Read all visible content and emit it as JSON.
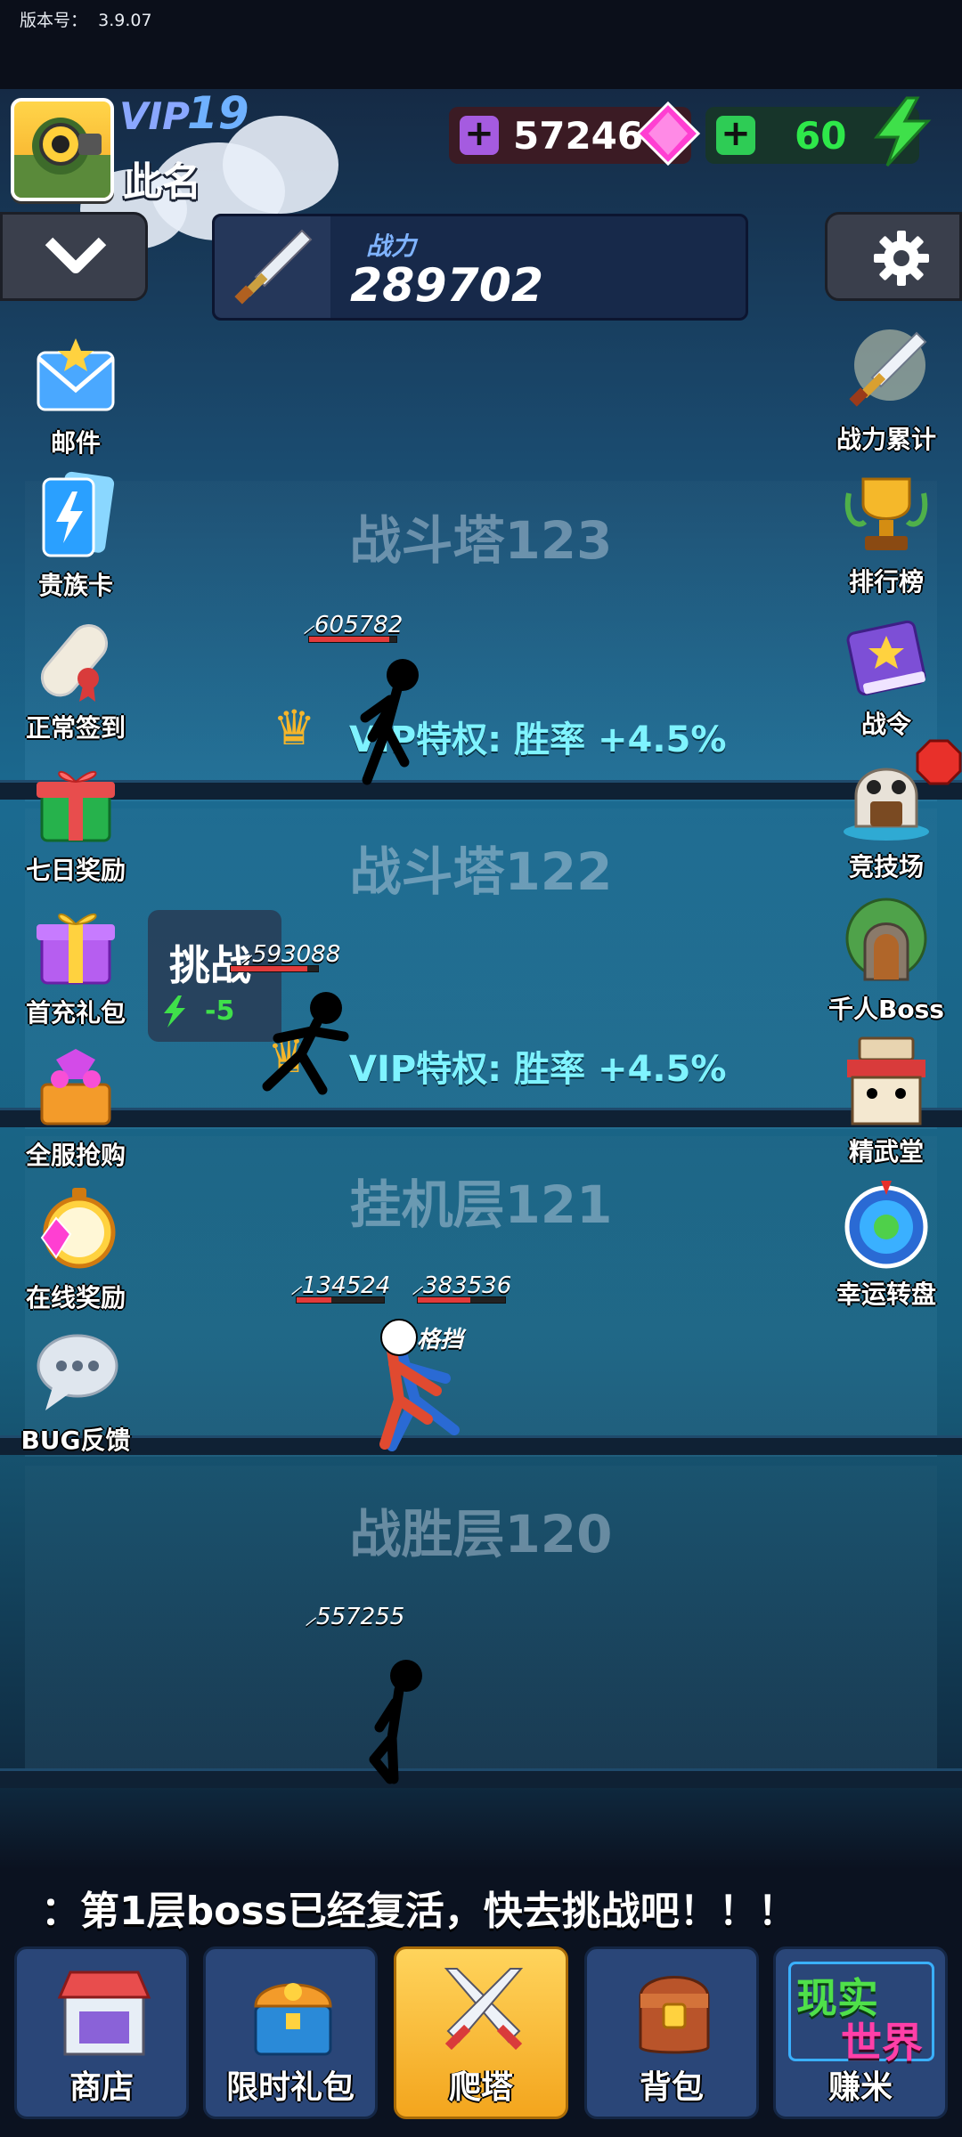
{
  "version": {
    "label": "版本号：",
    "value": "3.9.07"
  },
  "player": {
    "vip_label": "VIP",
    "vip_level": "19",
    "name": "此名"
  },
  "resources": {
    "gems": "57246",
    "energy": "60"
  },
  "power": {
    "label": "战力",
    "value": "289702"
  },
  "left_menu": [
    {
      "label": "邮件",
      "icon": "mail-icon"
    },
    {
      "label": "贵族卡",
      "icon": "noble-card-icon"
    },
    {
      "label": "正常签到",
      "icon": "scroll-icon"
    },
    {
      "label": "七日奖励",
      "icon": "gift-icon"
    },
    {
      "label": "首充礼包",
      "icon": "gift-box-icon"
    },
    {
      "label": "全服抢购",
      "icon": "treasure-icon"
    },
    {
      "label": "在线奖励",
      "icon": "stopwatch-icon"
    },
    {
      "label": "BUG反馈",
      "icon": "chat-bubble-icon"
    }
  ],
  "right_menu": [
    {
      "label": "战力累计",
      "icon": "sword-icon"
    },
    {
      "label": "排行榜",
      "icon": "trophy-icon"
    },
    {
      "label": "战令",
      "icon": "book-icon"
    },
    {
      "label": "竞技场",
      "icon": "arena-icon"
    },
    {
      "label": "千人Boss",
      "icon": "boss-gate-icon"
    },
    {
      "label": "精武堂",
      "icon": "dojo-icon"
    },
    {
      "label": "幸运转盘",
      "icon": "wheel-icon"
    }
  ],
  "floors": [
    {
      "title": "战斗塔123",
      "vip_text": "VIP特权: 胜率 +4.5%",
      "enemy_power": "605782"
    },
    {
      "title": "战斗塔122",
      "vip_text": "VIP特权: 胜率 +4.5%",
      "enemy_power": "593088"
    },
    {
      "title": "挂机层121",
      "power_a": "134524",
      "power_b": "383536",
      "block_text": "格挡"
    },
    {
      "title": "战胜层120",
      "enemy_power": "557255"
    }
  ],
  "challenge": {
    "label": "挑战",
    "cost": "-5"
  },
  "ticker": "：第1层boss已经复活，快去挑战吧！！！",
  "nav": [
    {
      "label": "商店",
      "icon": "shop-icon"
    },
    {
      "label": "限时礼包",
      "icon": "treasure-chest-icon"
    },
    {
      "label": "爬塔",
      "icon": "crossed-swords-icon",
      "active": true
    },
    {
      "label": "背包",
      "icon": "backpack-icon"
    },
    {
      "label": "赚米",
      "icon": "real-world-icon",
      "badge_top": "现实",
      "badge_bottom": "世界"
    }
  ],
  "colors": {
    "vip": "#8aa7ff",
    "gem": "#ff3fd2",
    "energy": "#35e04a",
    "nav_active": "#f3a51d"
  }
}
